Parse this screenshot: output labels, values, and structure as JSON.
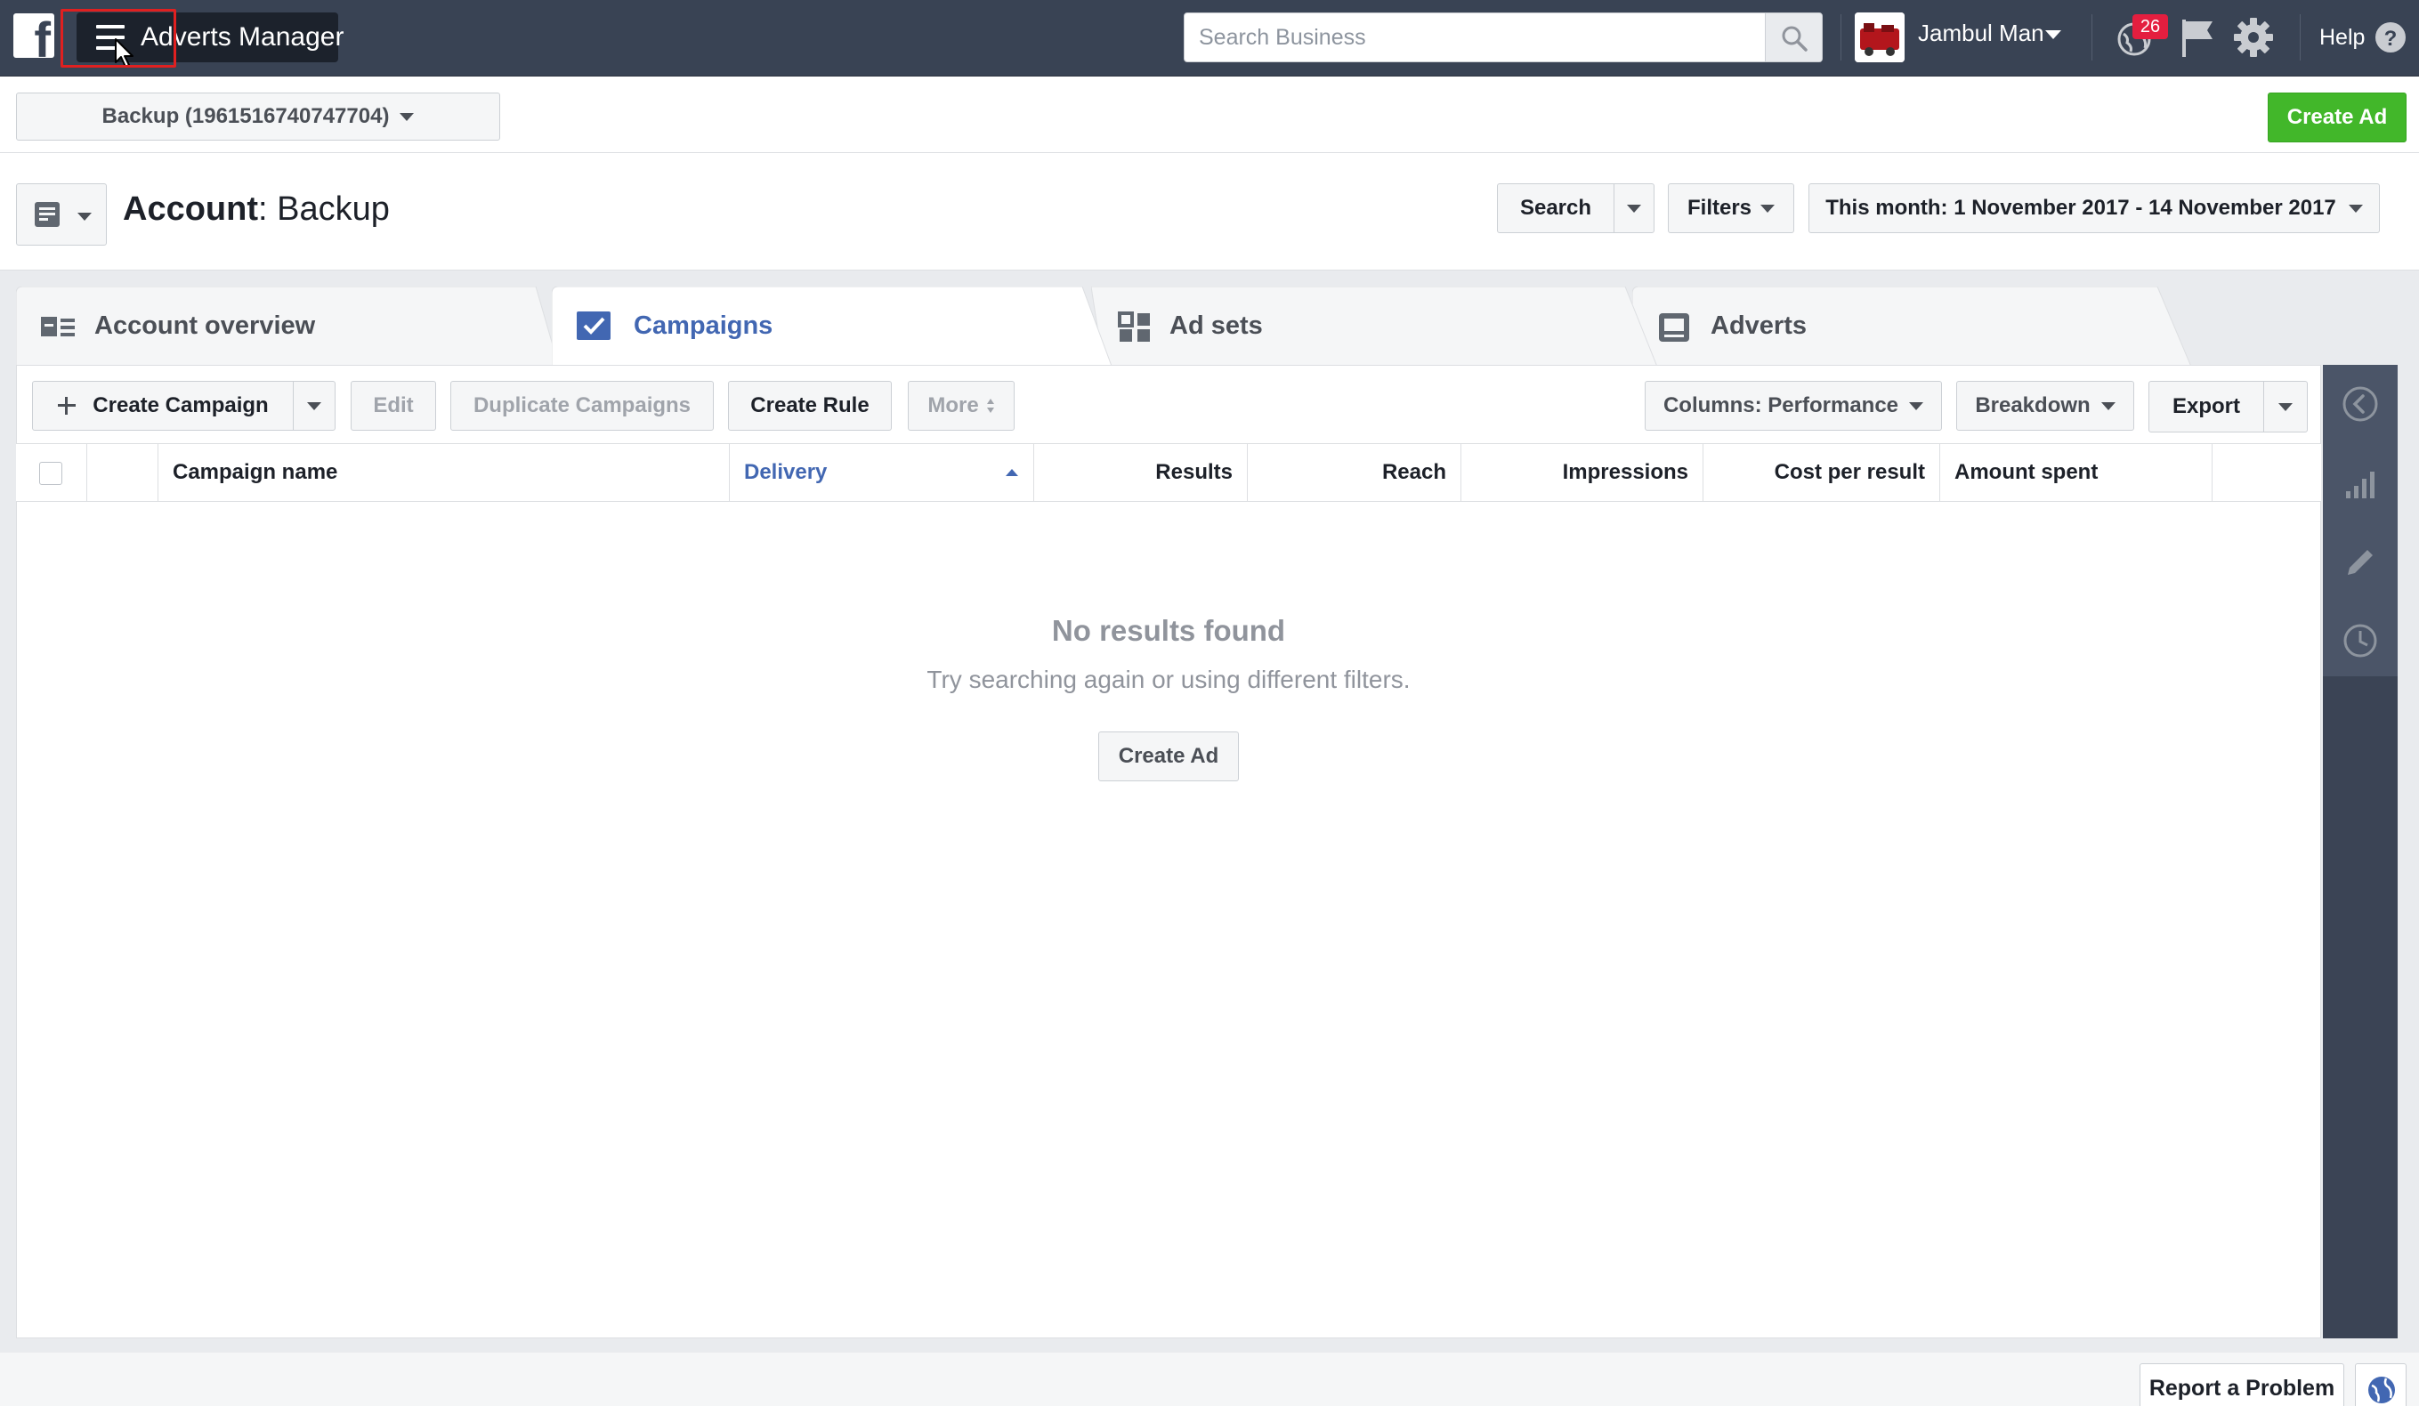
{
  "topbar": {
    "logo_glyph": "f",
    "app_title": "Adverts Manager",
    "search_placeholder": "Search Business",
    "user_name": "Jambul Man",
    "notification_count": "26",
    "help_label": "Help"
  },
  "account_bar": {
    "account_selector_label": "Backup (1961516740747704)",
    "create_ad_label": "Create Ad"
  },
  "header": {
    "title_prefix": "Account",
    "title_name": ": Backup",
    "search_label": "Search",
    "filters_label": "Filters",
    "date_range_label": "This month: 1 November 2017 - 14 November 2017"
  },
  "tabs": [
    {
      "label": "Account overview",
      "active": false
    },
    {
      "label": "Campaigns",
      "active": true
    },
    {
      "label": "Ad sets",
      "active": false
    },
    {
      "label": "Adverts",
      "active": false
    }
  ],
  "toolbar": {
    "create_campaign_label": "Create Campaign",
    "edit_label": "Edit",
    "duplicate_label": "Duplicate Campaigns",
    "create_rule_label": "Create Rule",
    "more_label": "More",
    "columns_label": "Columns: Performance",
    "breakdown_label": "Breakdown",
    "export_label": "Export"
  },
  "table": {
    "columns": [
      "Campaign name",
      "Delivery",
      "Results",
      "Reach",
      "Impressions",
      "Cost per result",
      "Amount spent"
    ],
    "sorted_column": "Delivery"
  },
  "empty_state": {
    "title": "No results found",
    "subtitle": "Try searching again or using different filters.",
    "button_label": "Create Ad"
  },
  "footer": {
    "report_label": "Report a Problem"
  },
  "colors": {
    "topbar": "#394354",
    "primary_green": "#42b72a",
    "link_blue": "#4267b2",
    "badge_red": "#e41e3f",
    "rail": "#3b4455"
  },
  "icons": {
    "menu": "hamburger-icon",
    "search": "search-icon",
    "notifications": "globe-notification-icon",
    "flag": "flag-icon",
    "settings": "gear-icon",
    "help": "question-icon",
    "rail": [
      "collapse-left-icon",
      "bar-chart-icon",
      "pencil-icon",
      "clock-icon"
    ]
  }
}
